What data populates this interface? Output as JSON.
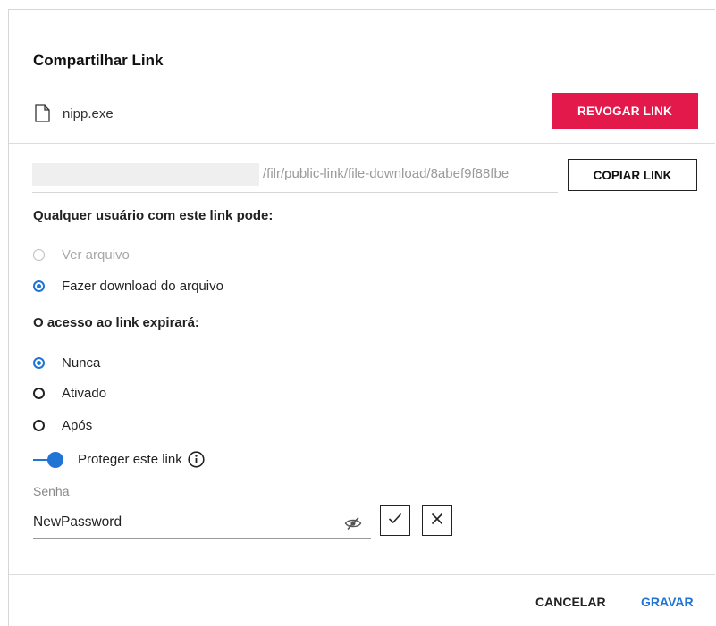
{
  "dialog": {
    "title": "Compartilhar Link",
    "file": {
      "icon": "document-icon",
      "name": "nipp.exe"
    },
    "revoke_label": "REVOGAR LINK",
    "link_url": "/filr/public-link/file-download/8abef9f88fbe",
    "copy_label": "COPIAR LINK",
    "permissions": {
      "heading": "Qualquer usuário com este link pode:",
      "options": [
        {
          "label": "Ver arquivo",
          "state": "disabled"
        },
        {
          "label": "Fazer download do arquivo",
          "state": "checked"
        }
      ]
    },
    "expiration": {
      "heading": "O acesso ao link expirará:",
      "options": [
        {
          "label": "Nunca",
          "state": "checked"
        },
        {
          "label": "Ativado",
          "state": "unchecked"
        },
        {
          "label": "Após",
          "state": "unchecked"
        }
      ]
    },
    "protect": {
      "label": "Proteger este link",
      "enabled": true,
      "info_icon": "info-icon"
    },
    "password": {
      "caption": "Senha",
      "value": "NewPassword",
      "reveal_icon": "eye-slash-icon"
    },
    "confirm_icon": "check-icon",
    "clear_icon": "close-icon",
    "footer": {
      "cancel_label": "CANCELAR",
      "save_label": "GRAVAR"
    }
  },
  "colors": {
    "accent": "#1f74d6",
    "danger": "#e4194b",
    "text": "#222222",
    "muted": "#a8a8a8"
  }
}
